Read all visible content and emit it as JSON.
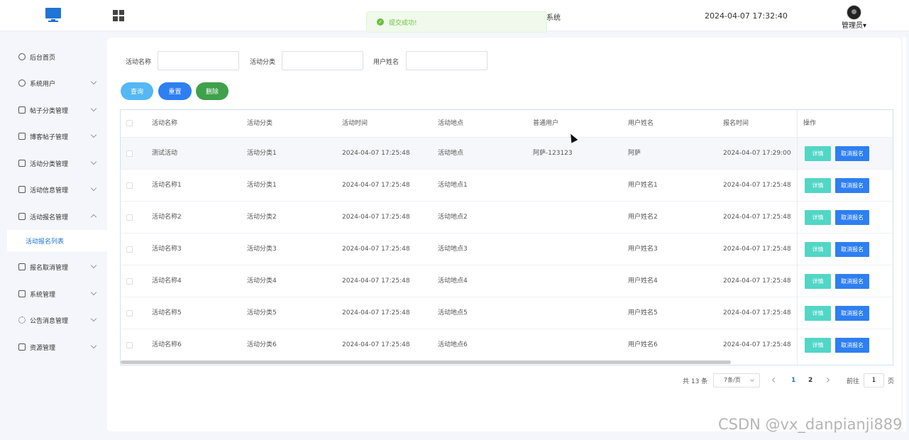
{
  "header": {
    "system_title_fragment": "系统",
    "datetime": "2024-04-07 17:32:40",
    "user_label": "管理员▾"
  },
  "toast": {
    "message": "提交成功!"
  },
  "sidebar": {
    "items": [
      {
        "label": "后台首页",
        "icon": "dashboard-icon"
      },
      {
        "label": "系统用户",
        "icon": "user-icon"
      },
      {
        "label": "帖子分类管理",
        "icon": "folder-icon"
      },
      {
        "label": "博客帖子管理",
        "icon": "folder-icon"
      },
      {
        "label": "活动分类管理",
        "icon": "folder-icon"
      },
      {
        "label": "活动信息管理",
        "icon": "folder-icon"
      },
      {
        "label": "活动报名管理",
        "icon": "folder-icon"
      },
      {
        "label": "报名取消管理",
        "icon": "folder-icon"
      },
      {
        "label": "系统管理",
        "icon": "folder-icon"
      },
      {
        "label": "公告消息管理",
        "icon": "loading-icon"
      },
      {
        "label": "资源管理",
        "icon": "printer-icon"
      }
    ],
    "active_sub": "活动报名列表"
  },
  "search": {
    "name_label": "活动名称",
    "category_label": "活动分类",
    "username_label": "用户姓名"
  },
  "actions": {
    "query": "查询",
    "reset": "重置",
    "delete": "删除"
  },
  "table": {
    "headers": [
      "活动名称",
      "活动分类",
      "活动时间",
      "活动地点",
      "普通用户",
      "用户姓名",
      "报名时间",
      "操作"
    ],
    "rows": [
      [
        "测试活动",
        "活动分类1",
        "2024-04-07 17:25:48",
        "活动地点",
        "阿萨-123123",
        "阿萨",
        "2024-04-07 17:29:00"
      ],
      [
        "活动名称1",
        "活动分类1",
        "2024-04-07 17:25:48",
        "活动地点1",
        "",
        "用户姓名1",
        "2024-04-07 17:25:48"
      ],
      [
        "活动名称2",
        "活动分类2",
        "2024-04-07 17:25:48",
        "活动地点2",
        "",
        "用户姓名2",
        "2024-04-07 17:25:48"
      ],
      [
        "活动名称3",
        "活动分类3",
        "2024-04-07 17:25:48",
        "活动地点3",
        "",
        "用户姓名3",
        "2024-04-07 17:25:48"
      ],
      [
        "活动名称4",
        "活动分类4",
        "2024-04-07 17:25:48",
        "活动地点4",
        "",
        "用户姓名4",
        "2024-04-07 17:25:48"
      ],
      [
        "活动名称5",
        "活动分类5",
        "2024-04-07 17:25:48",
        "活动地点5",
        "",
        "用户姓名5",
        "2024-04-07 17:25:48"
      ],
      [
        "活动名称6",
        "活动分类6",
        "2024-04-07 17:25:48",
        "活动地点6",
        "",
        "用户姓名6",
        "2024-04-07 17:25:48"
      ]
    ],
    "detail_label": "详情",
    "cancel_label": "取消报名"
  },
  "pagination": {
    "total": "共 13 条",
    "page_size": "7条/页",
    "pages": [
      "1",
      "2"
    ],
    "current": "1",
    "goto_label": "前往",
    "goto_value": "1",
    "page_suffix": "页"
  },
  "watermark": "CSDN @vx_danpianji889"
}
